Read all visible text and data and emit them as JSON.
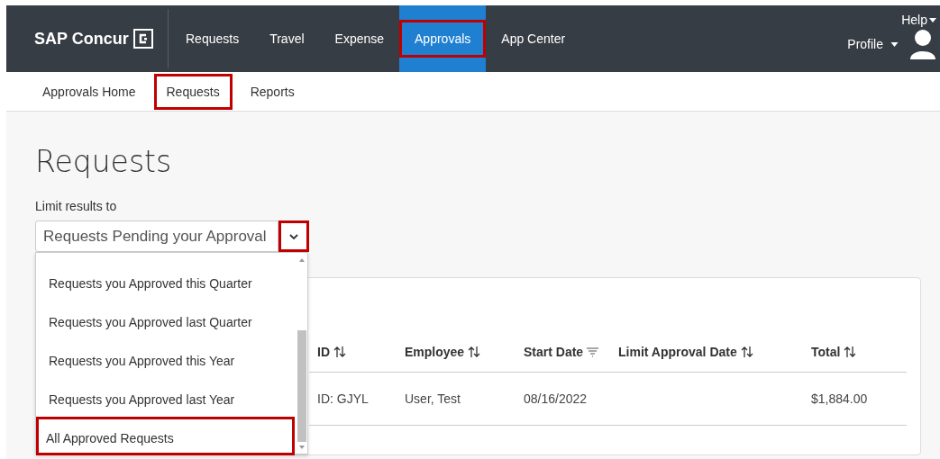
{
  "brand": {
    "name": "SAP Concur"
  },
  "nav": [
    {
      "label": "Requests",
      "selected": false,
      "highlighted": false
    },
    {
      "label": "Travel",
      "selected": false,
      "highlighted": false
    },
    {
      "label": "Expense",
      "selected": false,
      "highlighted": false
    },
    {
      "label": "Approvals",
      "selected": true,
      "highlighted": true
    },
    {
      "label": "App Center",
      "selected": false,
      "highlighted": false
    }
  ],
  "help": "Help",
  "profile": "Profile",
  "subnav": [
    {
      "label": "Approvals Home",
      "highlighted": false
    },
    {
      "label": "Requests",
      "highlighted": true
    },
    {
      "label": "Reports",
      "highlighted": false
    }
  ],
  "page_title": "Requests",
  "filter": {
    "label": "Limit results to",
    "value": "Requests Pending your Approval",
    "toggle_highlighted": true,
    "options": [
      {
        "label": "Requests you Approved this Quarter",
        "highlighted": false
      },
      {
        "label": "Requests you Approved last Quarter",
        "highlighted": false
      },
      {
        "label": "Requests you Approved this Year",
        "highlighted": false
      },
      {
        "label": "Requests you Approved last Year",
        "highlighted": false
      },
      {
        "label": "All Approved Requests",
        "highlighted": true
      }
    ]
  },
  "table": {
    "columns": [
      {
        "label": "ID",
        "kind": "sortable"
      },
      {
        "label": "Employee",
        "kind": "sortable"
      },
      {
        "label": "Start Date",
        "kind": "sorted"
      },
      {
        "label": "Limit Approval Date",
        "kind": "sortable"
      },
      {
        "label": "Total",
        "kind": "sortable"
      }
    ],
    "rows": [
      [
        "ID: GJYL",
        "User, Test",
        "08/16/2022",
        "",
        "$1,884.00"
      ]
    ]
  }
}
